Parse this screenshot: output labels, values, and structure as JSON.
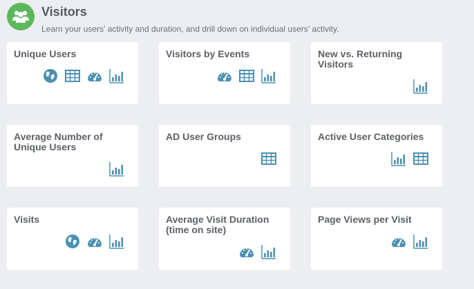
{
  "header": {
    "title": "Visitors",
    "subtitle": "Learn your users’ activity and duration, and drill down on individual users’ activity.",
    "icon": "users-group-icon",
    "icon_color": "#5cb85c"
  },
  "icon_color": "#4a90b0",
  "tiles": [
    {
      "title": "Unique Users",
      "icons": [
        "globe-icon",
        "table-icon",
        "gauge-icon",
        "bar-chart-icon"
      ]
    },
    {
      "title": "Visitors by Events",
      "icons": [
        "gauge-icon",
        "table-icon",
        "bar-chart-icon"
      ]
    },
    {
      "title": "New vs. Returning Visitors",
      "icons": [
        "bar-chart-icon"
      ]
    },
    {
      "title": "Average Number of Unique Users",
      "icons": [
        "bar-chart-icon"
      ]
    },
    {
      "title": "AD User Groups",
      "icons": [
        "table-icon"
      ]
    },
    {
      "title": "Active User Categories",
      "icons": [
        "bar-chart-icon",
        "table-icon"
      ]
    },
    {
      "title": "Visits",
      "icons": [
        "globe-icon",
        "gauge-icon",
        "bar-chart-icon"
      ]
    },
    {
      "title": "Average Visit Duration (time on site)",
      "icons": [
        "gauge-icon",
        "bar-chart-icon"
      ]
    },
    {
      "title": "Page Views per Visit",
      "icons": [
        "gauge-icon",
        "bar-chart-icon"
      ]
    }
  ]
}
